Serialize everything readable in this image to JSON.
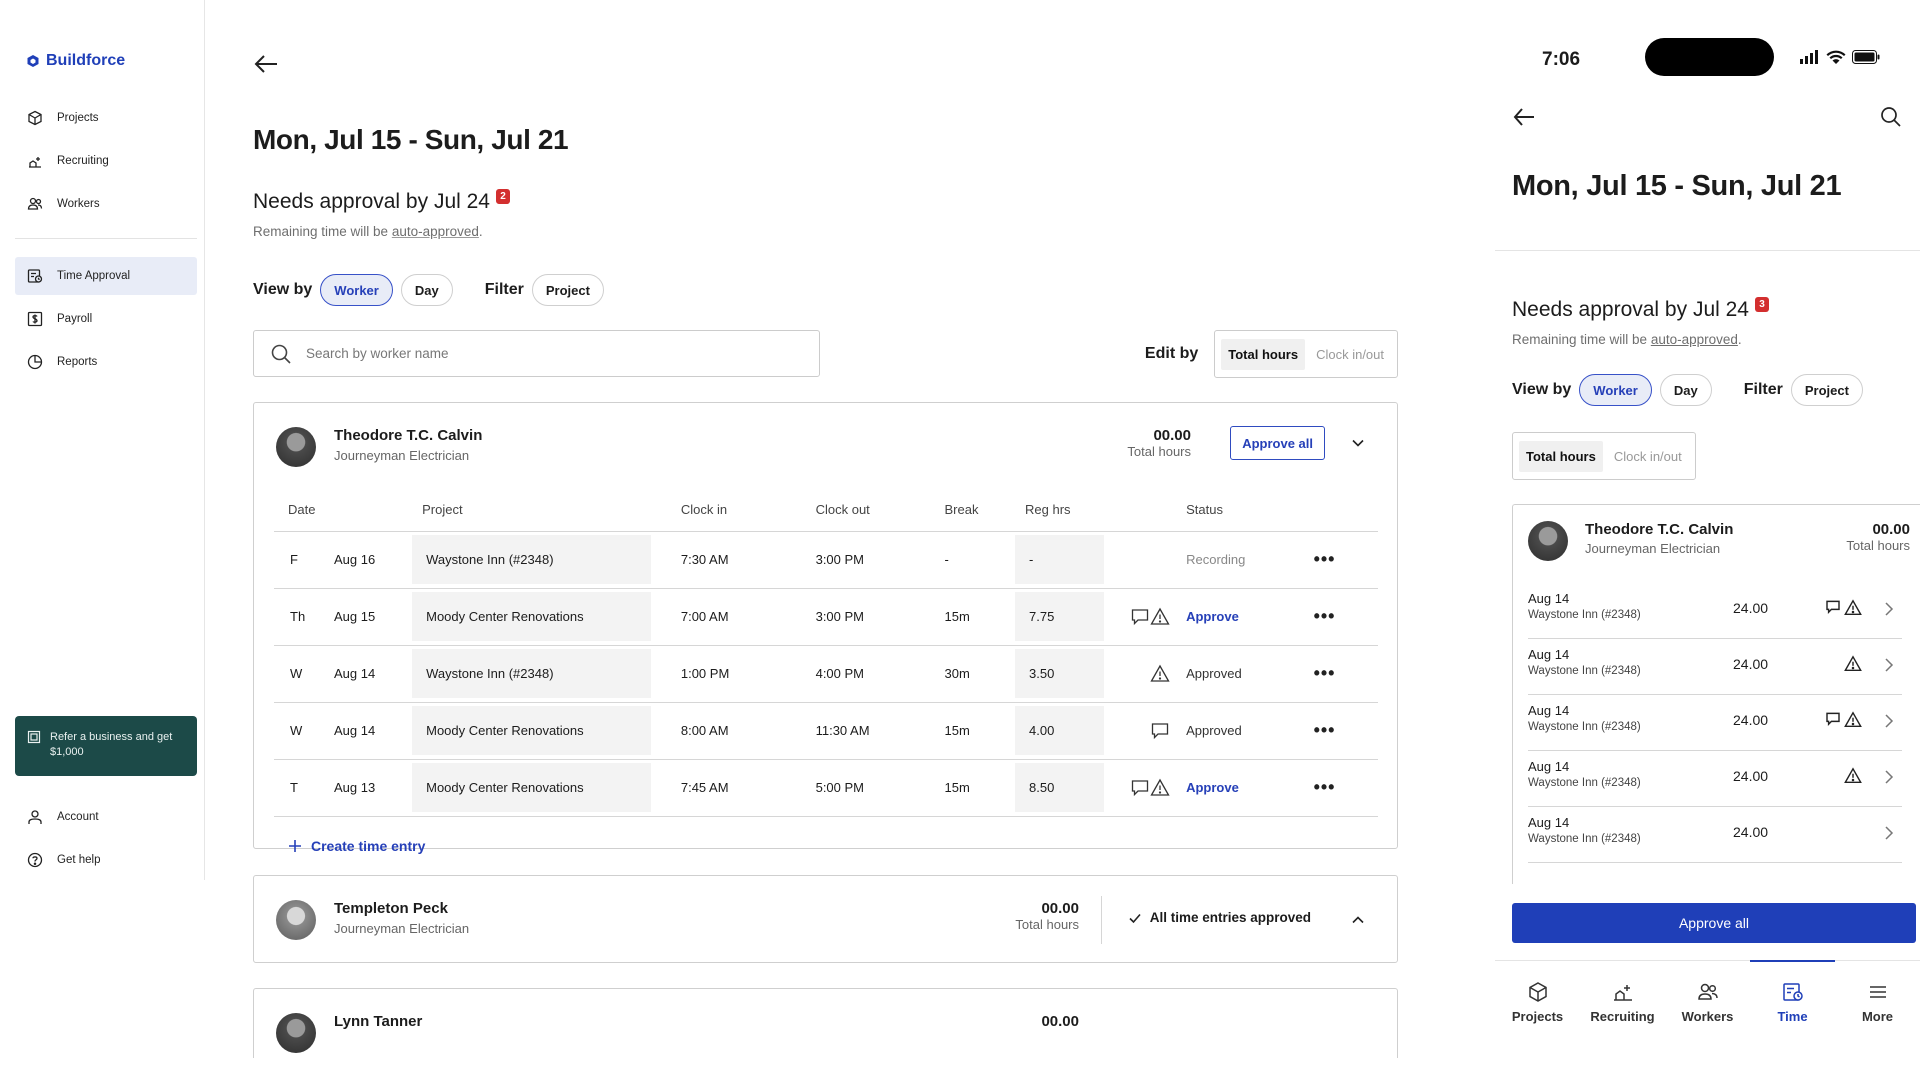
{
  "brand": {
    "name": "Buildforce",
    "color": "#1f3fb8"
  },
  "sidebar": {
    "items": [
      {
        "label": "Projects",
        "icon": "cube-icon"
      },
      {
        "label": "Recruiting",
        "icon": "recruiting-icon"
      },
      {
        "label": "Workers",
        "icon": "workers-icon"
      },
      {
        "label": "Time Approval",
        "icon": "time-approval-icon",
        "active": true
      },
      {
        "label": "Payroll",
        "icon": "dollar-icon"
      },
      {
        "label": "Reports",
        "icon": "pie-chart-icon"
      }
    ],
    "refer": "Refer a business and get $1,000",
    "account": "Account",
    "help": "Get help"
  },
  "main": {
    "title": "Mon, Jul 15 - Sun, Jul 21",
    "approval_heading": "Needs approval by Jul 24",
    "approval_badge": "2",
    "remaining_prefix": "Remaining time will be ",
    "remaining_link": "auto-approved",
    "remaining_suffix": ".",
    "view_by_label": "View by",
    "view_worker": "Worker",
    "view_day": "Day",
    "filter_label": "Filter",
    "filter_project": "Project",
    "search_placeholder": "Search by worker name",
    "edit_by_label": "Edit by",
    "edit_total": "Total hours",
    "edit_clock": "Clock in/out"
  },
  "workers": [
    {
      "name": "Theodore T.C. Calvin",
      "role": "Journeyman Electrician",
      "total": "00.00",
      "total_label": "Total hours",
      "approve_all": "Approve all",
      "columns": [
        "Date",
        "Project",
        "Clock in",
        "Clock out",
        "Break",
        "Reg hrs",
        "Status"
      ],
      "entries": [
        {
          "dow": "F",
          "date": "Aug 16",
          "project": "Waystone Inn (#2348)",
          "in": "7:30 AM",
          "out": "3:00 PM",
          "brk": "-",
          "reg": "-",
          "comment": false,
          "warn": false,
          "status": "Recording",
          "status_type": "recording"
        },
        {
          "dow": "Th",
          "date": "Aug 15",
          "project": "Moody Center Renovations",
          "in": "7:00 AM",
          "out": "3:00 PM",
          "brk": "15m",
          "reg": "7.75",
          "comment": true,
          "warn": true,
          "status": "Approve",
          "status_type": "action"
        },
        {
          "dow": "W",
          "date": "Aug 14",
          "project": "Waystone Inn (#2348)",
          "in": "1:00 PM",
          "out": "4:00 PM",
          "brk": "30m",
          "reg": "3.50",
          "comment": false,
          "warn": true,
          "status": "Approved",
          "status_type": "approved"
        },
        {
          "dow": "W",
          "date": "Aug 14",
          "project": "Moody Center Renovations",
          "in": "8:00 AM",
          "out": "11:30 AM",
          "brk": "15m",
          "reg": "4.00",
          "comment": true,
          "warn": false,
          "status": "Approved",
          "status_type": "approved"
        },
        {
          "dow": "T",
          "date": "Aug 13",
          "project": "Moody Center Renovations",
          "in": "7:45 AM",
          "out": "5:00 PM",
          "brk": "15m",
          "reg": "8.50",
          "comment": true,
          "warn": true,
          "status": "Approve",
          "status_type": "action"
        }
      ],
      "create_entry": "Create time entry"
    },
    {
      "name": "Templeton Peck",
      "role": "Journeyman Electrician",
      "total": "00.00",
      "total_label": "Total hours",
      "all_approved": "All time entries approved"
    },
    {
      "name": "Lynn Tanner",
      "total": "00.00"
    }
  ],
  "mobile": {
    "clock": "7:06",
    "title": "Mon, Jul 15 - Sun, Jul 21",
    "approval_heading": "Needs approval by Jul 24",
    "approval_badge": "3",
    "remaining_prefix": "Remaining time will be ",
    "remaining_link": "auto-approved",
    "remaining_suffix": ".",
    "view_by_label": "View by",
    "view_worker": "Worker",
    "view_day": "Day",
    "filter_label": "Filter",
    "filter_project": "Project",
    "edit_total": "Total hours",
    "edit_clock": "Clock in/out",
    "worker_name": "Theodore T.C. Calvin",
    "worker_role": "Journeyman Electrician",
    "worker_total": "00.00",
    "worker_total_label": "Total hours",
    "entries": [
      {
        "date": "Aug 14",
        "project": "Waystone Inn (#2348)",
        "hours": "24.00",
        "comment": true,
        "warn": true
      },
      {
        "date": "Aug 14",
        "project": "Waystone Inn (#2348)",
        "hours": "24.00",
        "comment": false,
        "warn": true
      },
      {
        "date": "Aug 14",
        "project": "Waystone Inn (#2348)",
        "hours": "24.00",
        "comment": true,
        "warn": true
      },
      {
        "date": "Aug 14",
        "project": "Waystone Inn (#2348)",
        "hours": "24.00",
        "comment": false,
        "warn": true
      },
      {
        "date": "Aug 14",
        "project": "Waystone Inn (#2348)",
        "hours": "24.00",
        "comment": false,
        "warn": false
      }
    ],
    "approve_all": "Approve all",
    "tabs": [
      {
        "label": "Projects",
        "icon": "cube-icon"
      },
      {
        "label": "Recruiting",
        "icon": "recruiting-icon"
      },
      {
        "label": "Workers",
        "icon": "workers-icon"
      },
      {
        "label": "Time",
        "icon": "time-approval-icon",
        "active": true
      },
      {
        "label": "More",
        "icon": "menu-icon"
      }
    ]
  }
}
